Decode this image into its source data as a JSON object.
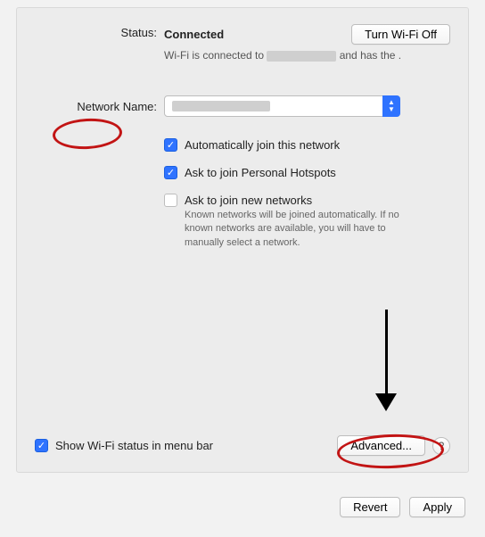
{
  "status": {
    "label": "Status:",
    "value": "Connected",
    "turnOffLabel": "Turn Wi-Fi Off",
    "subtext_prefix": "Wi-Fi is connected to ",
    "subtext_suffix": " and has the ."
  },
  "network": {
    "label": "Network Name:",
    "selected": ""
  },
  "options": {
    "autoJoin": {
      "label": "Automatically join this network",
      "checked": true
    },
    "askHotspots": {
      "label": "Ask to join Personal Hotspots",
      "checked": true
    },
    "askNewNetworks": {
      "label": "Ask to join new networks",
      "checked": false,
      "helper": "Known networks will be joined automatically. If no known networks are available, you will have to manually select a network."
    }
  },
  "footer": {
    "showStatusLabel": "Show Wi-Fi status in menu bar",
    "showStatusChecked": true,
    "advancedLabel": "Advanced...",
    "helpLabel": "?",
    "revertLabel": "Revert",
    "applyLabel": "Apply"
  }
}
